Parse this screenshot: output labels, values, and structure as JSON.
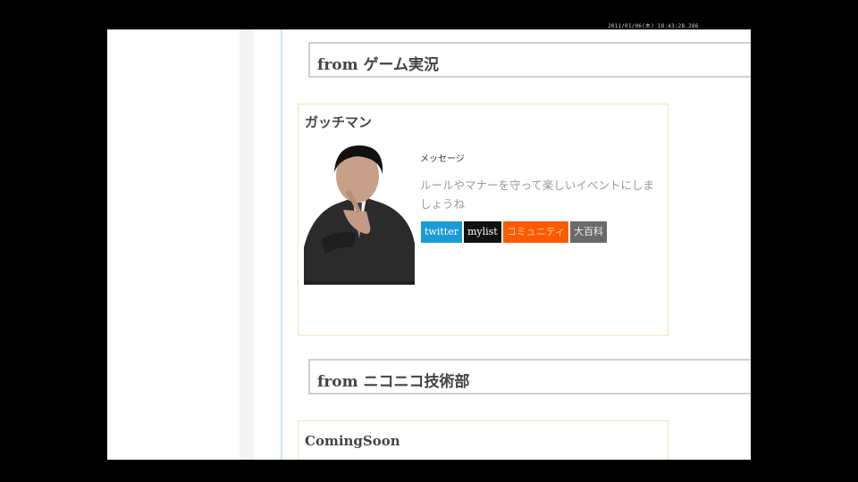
{
  "clock": "2011/01/06(木) 18:43:28.286",
  "sections": [
    {
      "header": "from ゲーム実況"
    },
    {
      "header": "from ニコニコ技術部"
    }
  ],
  "card1": {
    "title": "ガッチマン",
    "message_label": "メッセージ",
    "message": "ルールやマナーを守って楽しいイベントにしましょうね",
    "buttons": {
      "twitter": "twitter",
      "mylist": "mylist",
      "community": "コミュニティ",
      "daihyakka": "大百科"
    }
  },
  "card2": {
    "title": "ComingSoon"
  },
  "colors": {
    "twitter": "#1a9bd7",
    "mylist": "#111111",
    "community": "#ff5a00",
    "daihyakka": "#6a6a6a",
    "card_border": "#f5e3c2"
  },
  "icons": {
    "avatar": "man-in-suit-photo"
  }
}
